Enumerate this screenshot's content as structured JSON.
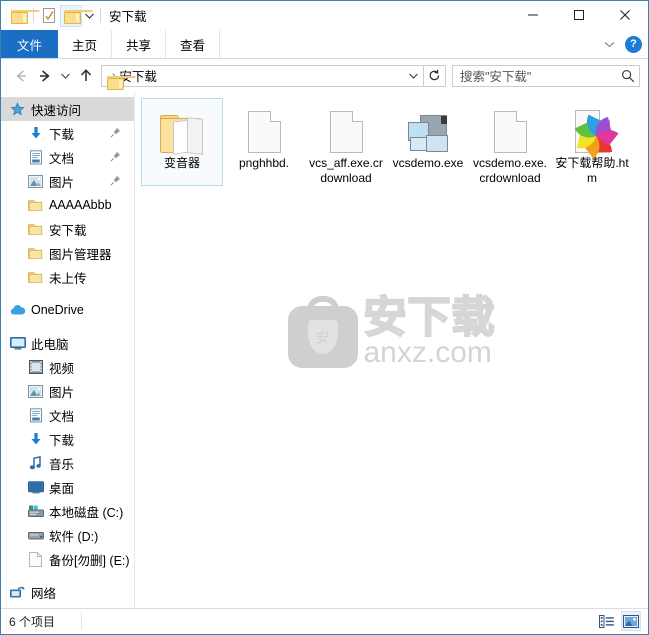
{
  "window": {
    "title": "安下载",
    "quick_access": [
      {
        "name": "folder-icon",
        "label": "文件夹"
      },
      {
        "name": "properties-icon",
        "label": "属性"
      },
      {
        "name": "new-folder-icon",
        "label": "新建文件夹"
      }
    ],
    "controls": {
      "minimize": "—",
      "maximize": "□",
      "close": "✕"
    }
  },
  "ribbon": {
    "tabs": [
      {
        "label": "文件",
        "active": true
      },
      {
        "label": "主页",
        "active": false
      },
      {
        "label": "共享",
        "active": false
      },
      {
        "label": "查看",
        "active": false
      }
    ],
    "expand_label": "展开功能区",
    "help_label": "?"
  },
  "address": {
    "back_label": "后退",
    "forward_label": "前进",
    "recent_label": "最近位置",
    "up_label": "向上",
    "crumb_separator": "›",
    "path": "安下载",
    "dropdown_label": "历史记录",
    "refresh_label": "刷新",
    "search_placeholder": "搜索\"安下载\"",
    "search_value": ""
  },
  "sidebar": {
    "items": [
      {
        "label": "快速访问",
        "icon": "star-icon",
        "level": 0,
        "selected": true,
        "pinned": false,
        "gap_before": false
      },
      {
        "label": "下载",
        "icon": "download-icon",
        "level": 1,
        "selected": false,
        "pinned": true,
        "gap_before": false
      },
      {
        "label": "文档",
        "icon": "document-icon",
        "level": 1,
        "selected": false,
        "pinned": true,
        "gap_before": false
      },
      {
        "label": "图片",
        "icon": "picture-icon",
        "level": 1,
        "selected": false,
        "pinned": true,
        "gap_before": false
      },
      {
        "label": "AAAAAbbb",
        "icon": "folder-icon",
        "level": 1,
        "selected": false,
        "pinned": false,
        "gap_before": false
      },
      {
        "label": "安下载",
        "icon": "folder-icon",
        "level": 1,
        "selected": false,
        "pinned": false,
        "gap_before": false
      },
      {
        "label": "图片管理器",
        "icon": "folder-icon",
        "level": 1,
        "selected": false,
        "pinned": false,
        "gap_before": false
      },
      {
        "label": "未上传",
        "icon": "folder-icon",
        "level": 1,
        "selected": false,
        "pinned": false,
        "gap_before": false
      },
      {
        "label": "OneDrive",
        "icon": "cloud-icon",
        "level": 0,
        "selected": false,
        "pinned": false,
        "gap_before": true
      },
      {
        "label": "此电脑",
        "icon": "computer-icon",
        "level": 0,
        "selected": false,
        "pinned": false,
        "gap_before": true
      },
      {
        "label": "视频",
        "icon": "video-icon",
        "level": 1,
        "selected": false,
        "pinned": false,
        "gap_before": false
      },
      {
        "label": "图片",
        "icon": "picture-icon",
        "level": 1,
        "selected": false,
        "pinned": false,
        "gap_before": false
      },
      {
        "label": "文档",
        "icon": "document-icon",
        "level": 1,
        "selected": false,
        "pinned": false,
        "gap_before": false
      },
      {
        "label": "下载",
        "icon": "download-icon",
        "level": 1,
        "selected": false,
        "pinned": false,
        "gap_before": false
      },
      {
        "label": "音乐",
        "icon": "music-icon",
        "level": 1,
        "selected": false,
        "pinned": false,
        "gap_before": false
      },
      {
        "label": "桌面",
        "icon": "desktop-icon",
        "level": 1,
        "selected": false,
        "pinned": false,
        "gap_before": false
      },
      {
        "label": "本地磁盘 (C:)",
        "icon": "system-drive-icon",
        "level": 1,
        "selected": false,
        "pinned": false,
        "gap_before": false
      },
      {
        "label": "软件 (D:)",
        "icon": "drive-icon",
        "level": 1,
        "selected": false,
        "pinned": false,
        "gap_before": false
      },
      {
        "label": "备份[勿删] (E:)",
        "icon": "drive-blank-icon",
        "level": 1,
        "selected": false,
        "pinned": false,
        "gap_before": false
      },
      {
        "label": "网络",
        "icon": "network-icon",
        "level": 0,
        "selected": false,
        "pinned": false,
        "gap_before": true
      }
    ]
  },
  "files": [
    {
      "name": "变音器",
      "icon": "open-folder-icon",
      "selected": true
    },
    {
      "name": "pnghhbd.",
      "icon": "blank-document-icon",
      "selected": false
    },
    {
      "name": "vcs_aff.exe.crdownload",
      "icon": "blank-document-icon",
      "selected": false
    },
    {
      "name": "vcsdemo.exe",
      "icon": "application-icon",
      "selected": false
    },
    {
      "name": "vcsdemo.exe.crdownload",
      "icon": "blank-document-icon",
      "selected": false
    },
    {
      "name": "安下载帮助.htm",
      "icon": "html-document-icon",
      "selected": false
    }
  ],
  "watermark": {
    "cn_text": "安下载",
    "en_text": "anxz.com",
    "shield_char": "安",
    "color": "#d2d2d2"
  },
  "status": {
    "item_count_text": "6 个项目",
    "views": [
      {
        "name": "details-view-button",
        "label": "详细信息",
        "active": false
      },
      {
        "name": "large-icons-view-button",
        "label": "大图标",
        "active": true
      }
    ]
  },
  "colors": {
    "accent": "#1a6fc4",
    "window_border": "#3c7fb1",
    "selection": "#d9d9d9",
    "item_selected_border": "#b9d9ee",
    "help_blue": "#1a7fd4"
  }
}
